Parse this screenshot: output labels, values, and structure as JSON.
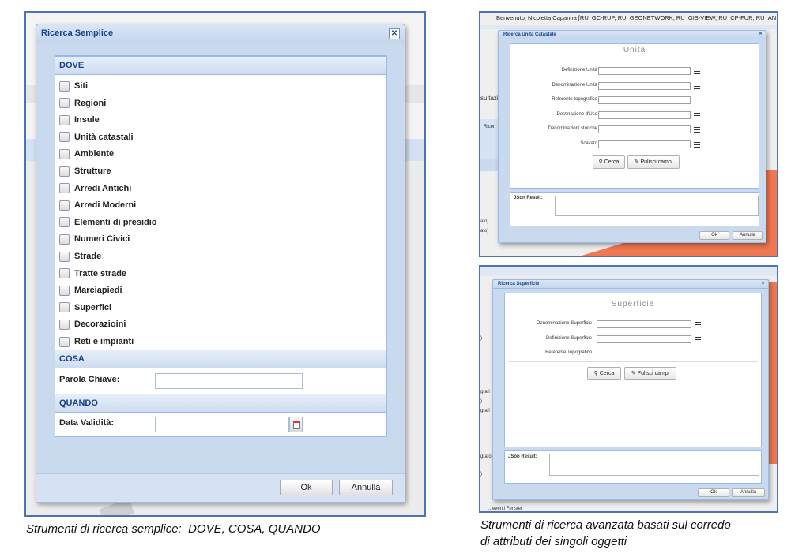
{
  "left_dialog": {
    "title": "Ricerca Semplice",
    "close_glyph": "✕",
    "dove": {
      "header": "DOVE",
      "items": [
        "Siti",
        "Regioni",
        "Insule",
        "Unità catastali",
        "Ambiente",
        "Strutture",
        "Arredi Antichi",
        "Arredi Moderni",
        "Elementi di presidio",
        "Numeri Civici",
        "Strade",
        "Tratte strade",
        "Marciapiedi",
        "Superfici",
        "Decorazioini",
        "Reti e impianti"
      ]
    },
    "cosa": {
      "header": "COSA",
      "label": "Parola Chiave:",
      "value": ""
    },
    "quando": {
      "header": "QUANDO",
      "label": "Data Validità:",
      "value": ""
    },
    "ok_label": "Ok",
    "cancel_label": "Annulla"
  },
  "caption_left": "Strumenti di ricerca semplice:  DOVE, COSA, QUANDO",
  "top_right": {
    "user_bar": "Benvenuto, Nicoletta Capanna [RU_GC-RUP, RU_GEONETWORK, RU_GIS-VIEW, RU_CP-FUR, RU_AN_",
    "bg_fragments": [
      "sultazi",
      "Ricer",
      "afo)",
      "afo)"
    ],
    "window_title": "Ricerca Unità Catastale",
    "heading": "Unità",
    "fields": [
      {
        "label": "Definizione Unità",
        "list": true
      },
      {
        "label": "Denominazione Unità",
        "list": true
      },
      {
        "label": "Referente topografico",
        "list": false
      },
      {
        "label": "Destinazione d'Uso",
        "list": true
      },
      {
        "label": "Denominazioni storiche",
        "list": true
      },
      {
        "label": "Scavato",
        "list": true
      }
    ],
    "search_label": "Cerca",
    "clear_label": "Pulisci campi",
    "json_label": "JSon Result:",
    "ok_label": "Ok",
    "cancel_label": "Annulla"
  },
  "bottom_right": {
    "bg_fragments": [
      ")",
      "grafi",
      ")",
      "grafi",
      "grafo",
      ")"
    ],
    "window_title": "Ricerca Superficie",
    "heading": "Superficie",
    "fields": [
      {
        "label": "Denominazione Superficie",
        "list": true
      },
      {
        "label": "Definizione Superficie",
        "list": true
      },
      {
        "label": "Referente Topografico",
        "list": false
      }
    ],
    "search_label": "Cerca",
    "clear_label": "Pulisci campi",
    "json_label": "JSon Result:",
    "ok_label": "Ok",
    "cancel_label": "Annulla",
    "footer_fragment": "...eventi Fonster"
  },
  "caption_right": [
    "Strumenti di ricerca avanzata basati sul corredo",
    "di attributi dei singoli oggetti"
  ],
  "colors": {
    "frame": "#4a74b6",
    "title": "#15428b",
    "window": "#c9d9ee",
    "map_orange": "#f07850"
  }
}
